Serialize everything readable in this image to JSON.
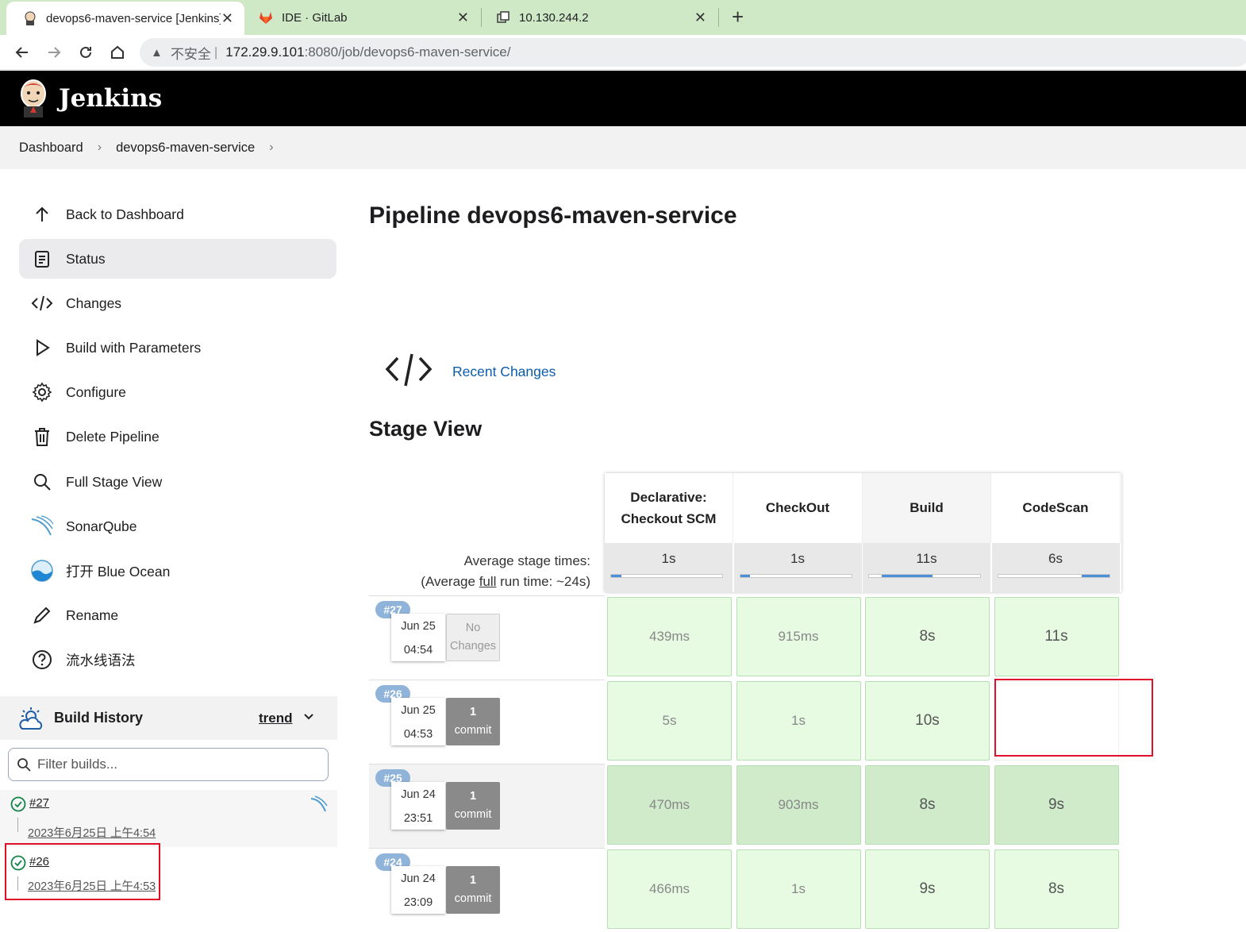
{
  "browser": {
    "tabs": [
      {
        "title": "devops6-maven-service [Jenkins]",
        "active": true,
        "icon": "jenkins-favicon"
      },
      {
        "title": "IDE · GitLab",
        "active": false,
        "icon": "gitlab-favicon"
      },
      {
        "title": "10.130.244.2",
        "active": false,
        "icon": "remote-desktop-favicon"
      }
    ],
    "insecure_label": "不安全",
    "url_host": "172.29.9.101",
    "url_path": ":8080/job/devops6-maven-service/"
  },
  "header": {
    "brand": "Jenkins"
  },
  "breadcrumbs": [
    "Dashboard",
    "devops6-maven-service"
  ],
  "sidebar": {
    "items": [
      {
        "label": "Back to Dashboard",
        "icon": "arrow-up-icon"
      },
      {
        "label": "Status",
        "icon": "document-icon",
        "active": true
      },
      {
        "label": "Changes",
        "icon": "code-icon"
      },
      {
        "label": "Build with Parameters",
        "icon": "play-icon"
      },
      {
        "label": "Configure",
        "icon": "gear-icon"
      },
      {
        "label": "Delete Pipeline",
        "icon": "trash-icon"
      },
      {
        "label": "Full Stage View",
        "icon": "search-icon"
      },
      {
        "label": "SonarQube",
        "icon": "sonarqube-icon"
      },
      {
        "label": "打开 Blue Ocean",
        "icon": "blue-ocean-icon"
      },
      {
        "label": "Rename",
        "icon": "pencil-icon"
      },
      {
        "label": "流水线语法",
        "icon": "help-icon"
      }
    ]
  },
  "build_history": {
    "title": "Build History",
    "trend": "trend",
    "filter_placeholder": "Filter builds...",
    "builds": [
      {
        "number": "#27",
        "date": "2023年6月25日 上午4:54",
        "status": "success"
      },
      {
        "number": "#26",
        "date": "2023年6月25日 上午4:53",
        "status": "success"
      }
    ]
  },
  "main": {
    "title": "Pipeline devops6-maven-service",
    "recent_changes": "Recent Changes",
    "stage_view_title": "Stage View",
    "avg_label_1": "Average stage times:",
    "avg_label_2_pre": "(Average ",
    "avg_label_2_full": "full",
    "avg_label_2_post": " run time: ~24s)"
  },
  "stages": [
    {
      "name": "Declarative: Checkout SCM",
      "name_lines": [
        "Declarative:",
        "Checkout SCM"
      ],
      "avg": "1s",
      "bar_fraction": 0.09
    },
    {
      "name": "CheckOut",
      "name_lines": [
        "CheckOut"
      ],
      "avg": "1s",
      "bar_fraction": 0.09
    },
    {
      "name": "Build",
      "name_lines": [
        "Build"
      ],
      "avg": "11s",
      "bar_fraction": 0.46
    },
    {
      "name": "CodeScan",
      "name_lines": [
        "CodeScan"
      ],
      "avg": "6s",
      "bar_fraction": 0.25
    }
  ],
  "runs": [
    {
      "number": "#27",
      "date": "Jun 25",
      "time": "04:54",
      "commits_n": "No",
      "commits_label": "Changes",
      "durations": [
        "439ms",
        "915ms",
        "8s",
        "11s"
      ]
    },
    {
      "number": "#26",
      "date": "Jun 25",
      "time": "04:53",
      "commits_n": "1",
      "commits_label": "commit",
      "durations": [
        "5s",
        "1s",
        "10s",
        ""
      ]
    },
    {
      "number": "#25",
      "date": "Jun 24",
      "time": "23:51",
      "commits_n": "1",
      "commits_label": "commit",
      "durations": [
        "470ms",
        "903ms",
        "8s",
        "9s"
      ]
    },
    {
      "number": "#24",
      "date": "Jun 24",
      "time": "23:09",
      "commits_n": "1",
      "commits_label": "commit",
      "durations": [
        "466ms",
        "1s",
        "9s",
        "8s"
      ]
    }
  ]
}
